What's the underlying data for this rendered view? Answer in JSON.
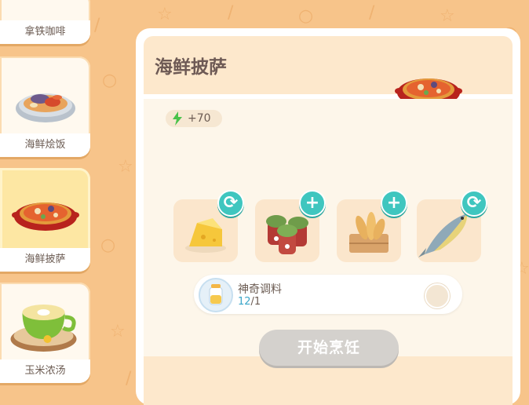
{
  "sidebar": {
    "items": [
      {
        "label": "拿铁咖啡",
        "state": "normal"
      },
      {
        "label": "海鲜烩饭",
        "state": "normal"
      },
      {
        "label": "海鲜披萨",
        "state": "selected"
      },
      {
        "label": "玉米浓汤",
        "state": "normal"
      }
    ]
  },
  "recipe": {
    "title": "海鲜披萨",
    "energy": "+70",
    "ingredients": [
      {
        "icon": "cheese-icon",
        "action": "swap"
      },
      {
        "icon": "mushroom-jar-icon",
        "action": "add"
      },
      {
        "icon": "bread-basket-icon",
        "action": "add"
      },
      {
        "icon": "fish-icon",
        "action": "swap"
      }
    ],
    "seasoning": {
      "name": "神奇调料",
      "have": "12",
      "need": "/1"
    },
    "cook_label": "开始烹饪"
  },
  "colors": {
    "background": "#f7c48a",
    "accent_teal": "#3fc6bf",
    "selected_card": "#fde7a3",
    "disabled_button": "#d4d1cd"
  }
}
